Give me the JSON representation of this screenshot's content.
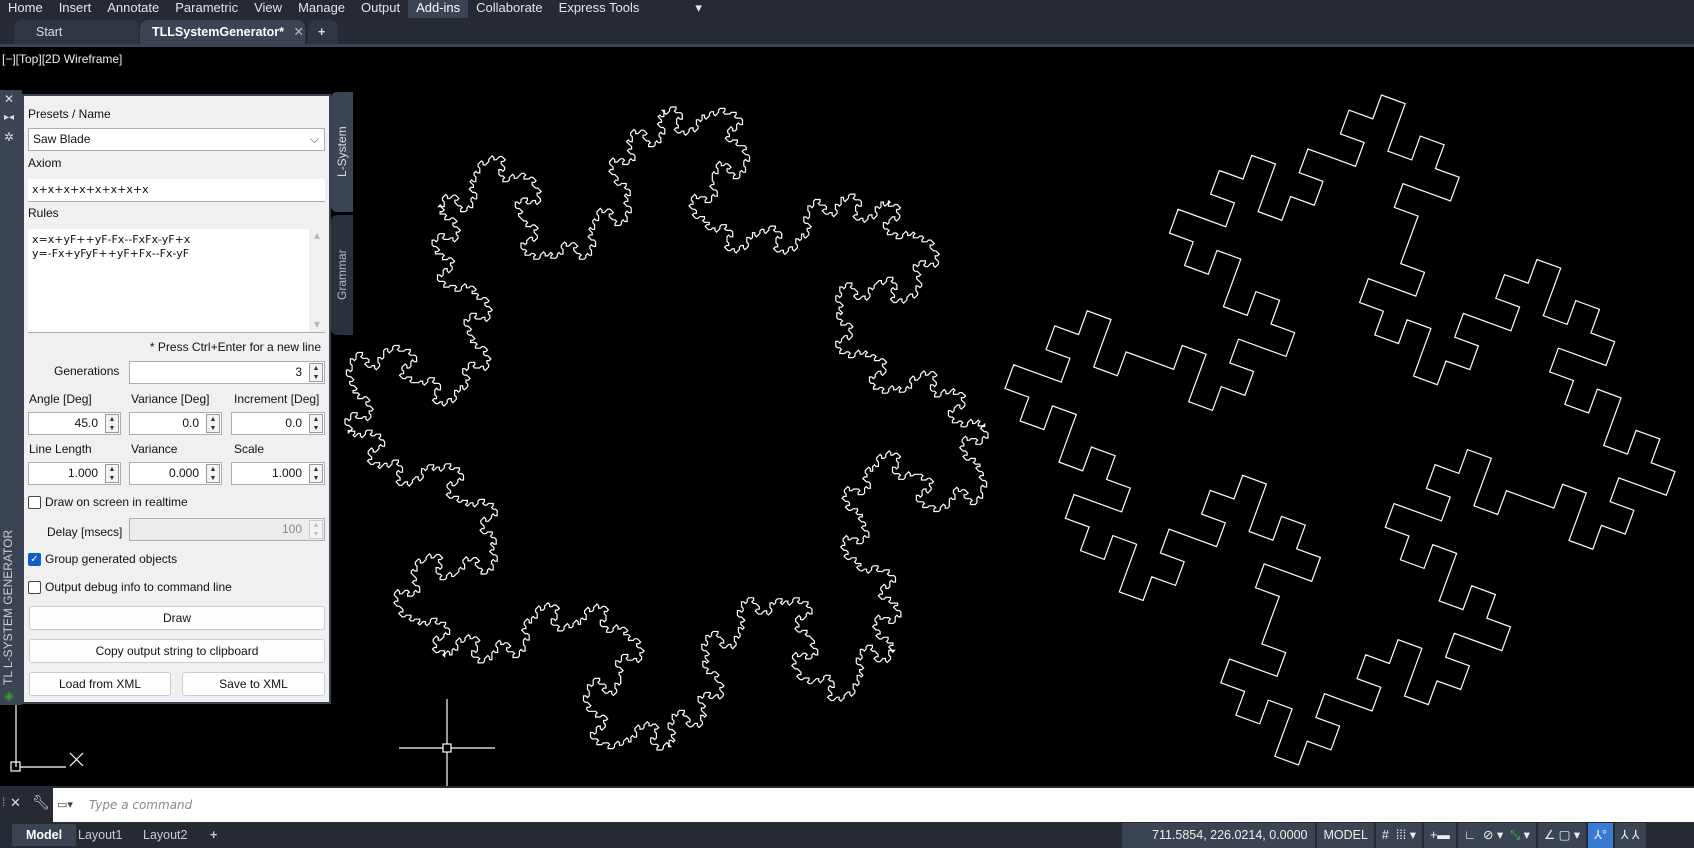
{
  "menu": [
    "Home",
    "Insert",
    "Annotate",
    "Parametric",
    "View",
    "Manage",
    "Output",
    "Add-ins",
    "Collaborate",
    "Express Tools"
  ],
  "menu_active": "Add-ins",
  "tabs": {
    "start": "Start",
    "active": "TLLSystemGenerator*",
    "close": "✕",
    "add": "+"
  },
  "viewport_label": "[−][Top][2D Wireframe]",
  "panel": {
    "title": "TL L-SYSTEM GENERATOR",
    "side_tabs": [
      "L-System",
      "Grammar"
    ],
    "presets_label": "Presets / Name",
    "preset_value": "Saw Blade",
    "axiom_label": "Axiom",
    "axiom_value": "x+x+x+x+x+x+x+x",
    "rules_label": "Rules",
    "rules_lines": [
      "x=x+yF++yF-Fx--FxFx-yF+x",
      "y=-Fx+yFyF++yF+Fx--Fx-yF"
    ],
    "hint": "* Press Ctrl+Enter for a new line",
    "generations_label": "Generations",
    "generations": "3",
    "angle_label": "Angle [Deg]",
    "angle": "45.0",
    "variance_deg_label": "Variance [Deg]",
    "variance_deg": "0.0",
    "increment_label": "Increment [Deg]",
    "increment": "0.0",
    "line_length_label": "Line Length",
    "line_length": "1.000",
    "variance_label": "Variance",
    "variance": "0.000",
    "scale_label": "Scale",
    "scale": "1.000",
    "realtime_label": "Draw on screen in realtime",
    "realtime": false,
    "delay_label": "Delay [msecs]",
    "delay": "100",
    "group_label": "Group generated objects",
    "group": true,
    "debug_label": "Output debug info to command line",
    "debug": false,
    "draw_btn": "Draw",
    "copy_btn": "Copy output string to clipboard",
    "load_btn": "Load from XML",
    "save_btn": "Save to XML"
  },
  "command": {
    "placeholder": "Type a command"
  },
  "layouts": [
    "Model",
    "Layout1",
    "Layout2",
    "+"
  ],
  "status": {
    "coords": "711.5854, 226.0214, 0.0000",
    "space": "MODEL"
  }
}
